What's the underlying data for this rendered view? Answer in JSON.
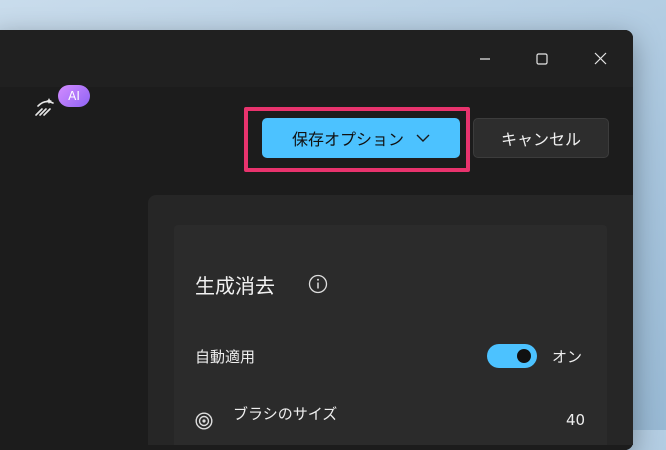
{
  "toolbar": {
    "ai_badge": "AI",
    "save_options_label": "保存オプション",
    "cancel_label": "キャンセル"
  },
  "panel": {
    "title": "生成消去",
    "auto_apply": {
      "label": "自動適用",
      "state_label": "オン",
      "enabled": true
    },
    "brush_size": {
      "label": "ブラシのサイズ",
      "value": "40"
    }
  },
  "colors": {
    "accent": "#4cc2ff",
    "highlight": "#e8336d",
    "ai_badge_start": "#d38cff",
    "ai_badge_end": "#8f63f5"
  },
  "icons": [
    "minimize-icon",
    "maximize-icon",
    "close-icon",
    "magic-wand-icon",
    "chevron-down-icon",
    "info-icon",
    "brush-size-icon"
  ]
}
